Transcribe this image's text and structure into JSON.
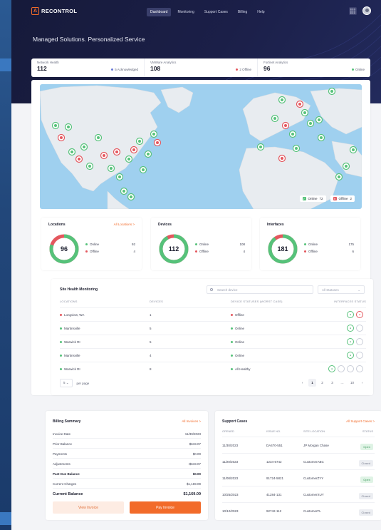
{
  "brand": {
    "logo_letter": "A",
    "name": "RECONTROL"
  },
  "nav": {
    "items": [
      "Dashboard",
      "Monitoring",
      "Support Cases",
      "Billing",
      "Help"
    ],
    "active": 0
  },
  "hero": {
    "title": "Managed Solutions. Personalized Service"
  },
  "stats": [
    {
      "label": "Network Health",
      "value": "112",
      "meta": "5 Acknowledged",
      "meta_color": "#6a7ad8"
    },
    {
      "label": "VMWare Analytics",
      "value": "108",
      "meta": "2 Offline",
      "meta_color": "#e4575e"
    },
    {
      "label": "Fortinet Analytics",
      "value": "96",
      "meta": "Online",
      "meta_color": "#56c27a"
    }
  ],
  "map_legend": {
    "online_label": "Online",
    "online_count": "72",
    "offline_label": "Offline",
    "offline_count": "2"
  },
  "donuts": [
    {
      "title": "Locations",
      "link": "All Locations >",
      "total": "96",
      "online_label": "Online",
      "online": "92",
      "offline_label": "Offline",
      "offline": "4",
      "online_fraction": 0.8
    },
    {
      "title": "Devices",
      "link": "",
      "total": "112",
      "online_label": "Online",
      "online": "108",
      "offline_label": "Offline",
      "offline": "4",
      "online_fraction": 0.92
    },
    {
      "title": "Interfaces",
      "link": "",
      "total": "181",
      "online_label": "Online",
      "online": "175",
      "offline_label": "Offline",
      "offline": "6",
      "online_fraction": 0.9
    }
  ],
  "health": {
    "title": "Site Health Monitoring",
    "search_placeholder": "Search device",
    "filter": "All Statuses",
    "columns": [
      "LOCATIONS",
      "DEVICES",
      "DEVICE STATUSES (WORST CASE)",
      "INTERFACES STATUS"
    ],
    "rows": [
      {
        "location": "Longview, WA",
        "loc_color": "#e4575e",
        "devices": "1",
        "status": "Offline",
        "status_color": "#e4575e"
      },
      {
        "location": "Martinsville",
        "loc_color": "#56c27a",
        "devices": "5",
        "status": "Online",
        "status_color": "#56c27a"
      },
      {
        "location": "Warwick RI",
        "loc_color": "#56c27a",
        "devices": "5",
        "status": "Online",
        "status_color": "#56c27a"
      },
      {
        "location": "Martinsville",
        "loc_color": "#56c27a",
        "devices": "4",
        "status": "Online",
        "status_color": "#56c27a"
      },
      {
        "location": "Warwick RI",
        "loc_color": "#56c27a",
        "devices": "8",
        "status": "All Healthy",
        "status_color": "#56c27a"
      }
    ],
    "per_page_value": "5",
    "per_page_label": "per page",
    "pages": [
      "‹",
      "1",
      "2",
      "3",
      "…",
      "10",
      "›"
    ]
  },
  "billing": {
    "title": "Billing Summary",
    "link": "All Invoices >",
    "rows": [
      {
        "label": "Invoice Date",
        "value": "11/30/2023"
      },
      {
        "label": "Prior Balance",
        "value": "$619.07"
      },
      {
        "label": "Payments",
        "value": "$0.00"
      },
      {
        "label": "Adjustments",
        "value": "-$619.07"
      },
      {
        "label": "Past Due Balance",
        "value": "$0.00"
      },
      {
        "label": "Current Charges",
        "value": "$1,169.09"
      }
    ],
    "total_label": "Current Balance",
    "total_value": "$1,169.09",
    "view_button": "View Invoice",
    "pay_button": "Pay Invoice"
  },
  "support": {
    "title": "Support Cases",
    "link": "All Support Cases >",
    "columns": [
      "OPENED",
      "ISSUE NO.",
      "SITE LOCATION",
      "STATUS"
    ],
    "rows": [
      {
        "opened": "11/30/2023",
        "issue": "DA470-551",
        "site": "JP Morgan Chase",
        "status": "Open"
      },
      {
        "opened": "11/20/2023",
        "issue": "1234-6742",
        "site": "CustomerABC",
        "status": "Closed"
      },
      {
        "opened": "11/08/2023",
        "issue": "91724-5821",
        "site": "CustomerZYY",
        "status": "Open"
      },
      {
        "opened": "10/25/2023",
        "issue": "41284-131",
        "site": "CustomerXUY",
        "status": "Closed"
      },
      {
        "opened": "10/12/2023",
        "issue": "92742-112",
        "site": "CustomerFL",
        "status": "Closed"
      }
    ]
  },
  "colors": {
    "accent": "#f26b2a",
    "online": "#56c27a",
    "offline": "#e4575e",
    "map_water": "#9fd0ef"
  }
}
